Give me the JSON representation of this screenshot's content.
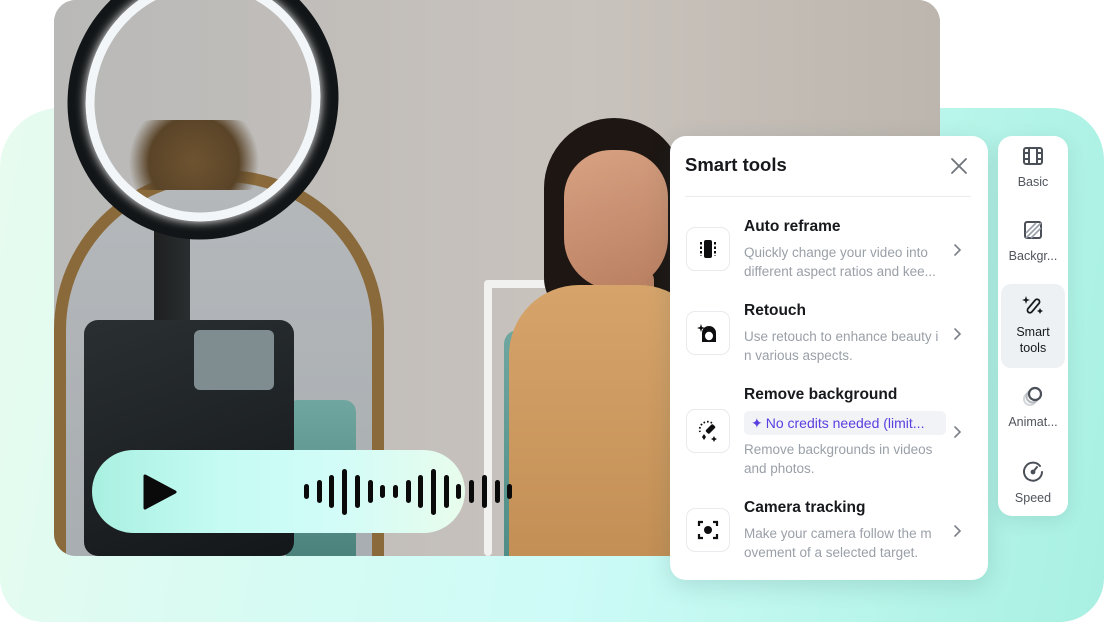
{
  "audio_player": {
    "play_icon": "play-icon",
    "waveform_levels": [
      0.32,
      0.5,
      0.72,
      1.0,
      0.72,
      0.5,
      0.3,
      0.3,
      0.5,
      0.72,
      1.0,
      0.72,
      0.32,
      0.5,
      0.72,
      0.5,
      0.32
    ]
  },
  "smart_tools_panel": {
    "title": "Smart tools",
    "close_icon": "close-icon",
    "tools": [
      {
        "name": "Auto reframe",
        "icon": "auto-reframe-icon",
        "description": "Quickly change your video into different aspect ratios and kee..."
      },
      {
        "name": "Retouch",
        "icon": "retouch-icon",
        "description": "Use retouch to enhance beauty i n various aspects."
      },
      {
        "name": "Remove background",
        "icon": "remove-background-icon",
        "badge": "No credits needed (limit...",
        "badge_icon": "✦",
        "description": "Remove backgrounds in videos and photos."
      },
      {
        "name": "Camera tracking",
        "icon": "camera-tracking-icon",
        "description": "Make your camera follow the m ovement of a selected target."
      }
    ]
  },
  "side_rail": {
    "items": [
      {
        "label": "Basic",
        "icon": "film-icon",
        "active": false
      },
      {
        "label": "Backgr...",
        "icon": "background-icon",
        "active": false
      },
      {
        "label": "Smart tools",
        "icon": "magic-wand-icon",
        "active": true
      },
      {
        "label": "Animat...",
        "icon": "animation-icon",
        "active": false
      },
      {
        "label": "Speed",
        "icon": "speed-icon",
        "active": false
      }
    ]
  },
  "colors": {
    "accent_purple": "#5a3ee0",
    "panel_bg_teal": "#a8f0e2",
    "text_primary": "#16181c",
    "text_secondary": "#9aa0a8"
  }
}
